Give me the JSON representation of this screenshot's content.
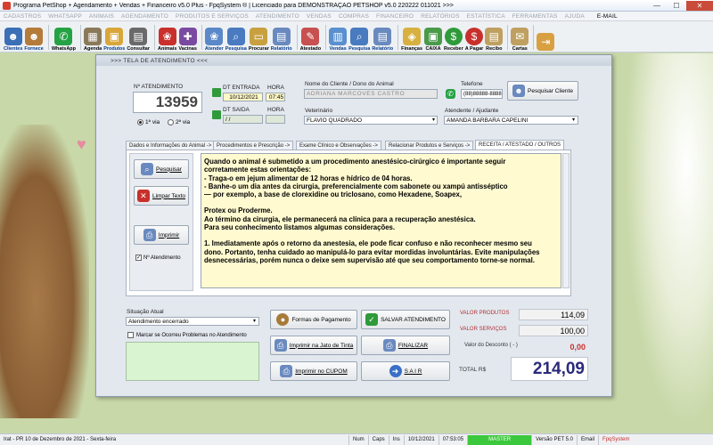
{
  "window": {
    "title": "Programa PetShop + Agendamento + Vendas + Financeiro v5.0 Plus - FpqSystem ® | Licenciado para  DEMONSTRAÇÃO PETSHOP v5.0 220222 011021 >>>",
    "min": "—",
    "max": "☐",
    "close": "✕"
  },
  "menu": [
    "CADASTROS",
    "WHATSAPP",
    "ANIMAIS",
    "AGENDAMENTO",
    "PRODUTOS E SERVIÇOS",
    "ATENDIMENTO",
    "VENDAS",
    "COMPRAS",
    "FINANCEIRO",
    "RELATÓRIOS",
    "ESTATÍSTICA",
    "FERRAMENTAS",
    "AJUDA",
    "E-MAIL"
  ],
  "toolbar": [
    {
      "label": "Clientes",
      "icon": "clients-icon",
      "color": "#3b6fb6"
    },
    {
      "label": "Fornece",
      "icon": "suppliers-icon",
      "color": "#b57b3a"
    },
    {
      "label": "WhatsApp",
      "icon": "whatsapp-icon",
      "color": "#25a244"
    },
    {
      "label": "Agenda",
      "icon": "agenda-icon",
      "color": "#8a7a5a"
    },
    {
      "label": "Produtos",
      "icon": "products-icon",
      "color": "#d8a63a"
    },
    {
      "label": "Consultar",
      "icon": "consult-icon",
      "color": "#6a6a6a"
    },
    {
      "label": "Animais",
      "icon": "paw-icon",
      "color": "#c9302c"
    },
    {
      "label": "Vacinas",
      "icon": "vaccine-icon",
      "color": "#7a4aa0"
    },
    {
      "label": "Atender",
      "icon": "attend-icon",
      "color": "#5a88c8"
    },
    {
      "label": "Pesquisa",
      "icon": "search-icon",
      "color": "#4a7abf"
    },
    {
      "label": "Procurar",
      "icon": "folder-icon",
      "color": "#c8a040"
    },
    {
      "label": "Relatório",
      "icon": "report-icon",
      "color": "#6a8abf"
    },
    {
      "label": "Atestado",
      "icon": "certificate-icon",
      "color": "#c85050"
    },
    {
      "label": "Vendas",
      "icon": "sales-icon",
      "color": "#5a90d0"
    },
    {
      "label": "Pesquisa",
      "icon": "search-icon",
      "color": "#4a7abf"
    },
    {
      "label": "Relatório",
      "icon": "report-icon",
      "color": "#6a8abf"
    },
    {
      "label": "Finanças",
      "icon": "finance-icon",
      "color": "#d8b040"
    },
    {
      "label": "CAIXA",
      "icon": "cashbox-icon",
      "color": "#4a9a4a"
    },
    {
      "label": "Receber",
      "icon": "dollar-green-icon",
      "color": "#2f9a3a"
    },
    {
      "label": "A Pagar",
      "icon": "dollar-red-icon",
      "color": "#c8302c"
    },
    {
      "label": "Recibo",
      "icon": "receipt-icon",
      "color": "#bfa060"
    },
    {
      "label": "Cartas",
      "icon": "letters-icon",
      "color": "#bfa060"
    },
    {
      "label": "",
      "icon": "exit-icon",
      "color": "#d8a040"
    }
  ],
  "dialog": {
    "title": ">>>     TELA DE ATENDIMENTO     <<<",
    "atendimento_label": "Nº ATENDIMENTO",
    "atendimento_number": "13959",
    "via1": "1ª via",
    "via2": "2ª via",
    "dt_entrada_label": "DT ENTRADA",
    "dt_entrada": "10/12/2021",
    "hora_label": "HORA",
    "hora_entrada": "07:45",
    "dt_saida_label": "DT SAIDA",
    "dt_saida": "  /  /",
    "hora_saida_label": "HORA",
    "cliente_label": "Nome do Cliente / Dono do Animal",
    "cliente": "ADRIANA MARCOVES CASTRO",
    "telefone_label": "Telefone",
    "telefone": "(88)88888-8888",
    "pesquisar_cliente": "Pesquisar Cliente",
    "veterinario_label": "Veterinário",
    "veterinario": "FLAVIO QUADRADO",
    "atendente_label": "Atendente / Ajudante",
    "atendente": "AMANDA BARBARA CAPELINI",
    "tabs": [
      "Dados e Informações do Animal ->",
      "Procedimentos e Prescrição ->",
      "Exame Clínico e Observações ->",
      "Relacionar Produtos e Serviços ->",
      "RECEITA / ATESTADO / OUTROS"
    ],
    "pesquisar": "Pesquisar",
    "limpar_texto": "Limpar Texto",
    "imprimir": "Imprimir",
    "n_atendimento_check": "Nº Atendimento",
    "text_lines": [
      "Quando o animal é submetido a um procedimento anestésico-cirúrgico é importante seguir",
      "corretamente estas orientações:",
      "- Traga-o em jejum alimentar de 12 horas e hídrico de 04 horas.",
      "- Banhe-o um dia antes da cirurgia, preferencialmente com sabonete ou xampú antisséptico",
      "— por exemplo, a base de clorexidine ou triclosano, como Hexadene, Soapex,",
      "",
      "Protex ou Proderme.",
      "Ao término da cirurgia, ele permanecerá na clínica para a recuperação anestésica.",
      "Para seu conhecimento listamos algumas considerações.",
      "",
      "1. Imediatamente após o retorno da anestesia, ele pode ficar confuso e não reconhecer mesmo seu",
      "dono. Portanto, tenha cuidado ao manipulá-lo para evitar mordidas involuntárias. Evite manipulações",
      "desnecessárias, porém nunca o deixe sem supervisão até que seu comportamento torne-se normal."
    ],
    "situacao_label": "Situação Atual",
    "situacao": "Atendimento encerrado",
    "marcar_problemas": "Marcar se Ocorreu Problemas no Atendimento",
    "formas_pagamento": "Formas de Pagamento",
    "salvar": "SALVAR  ATENDIMENTO",
    "imprimir_jato": "Imprimir na Jato de Tinta",
    "finalizar": "FINALIZAR",
    "imprimir_cupom": "Imprimir no CUPOM",
    "sair": "S A I R",
    "valor_produtos_label": "VALOR PRODUTOS",
    "valor_produtos": "114,09",
    "valor_servicos_label": "VALOR SERVIÇOS",
    "valor_servicos": "100,00",
    "valor_desconto_label": "Valor do Desconto ( - )",
    "valor_desconto": "0,00",
    "total_label": "TOTAL R$",
    "total": "214,09"
  },
  "status": {
    "location": "Irat - PR 10 de Dezembro de 2021 - Sexta-feira",
    "num": "Num",
    "caps": "Caps",
    "ins": "Ins",
    "date": "10/12/2021",
    "time": "07:53:05",
    "master": "MASTER",
    "version": "Versão PET 5.0",
    "email": "Email",
    "brand": "FpqSystem"
  }
}
